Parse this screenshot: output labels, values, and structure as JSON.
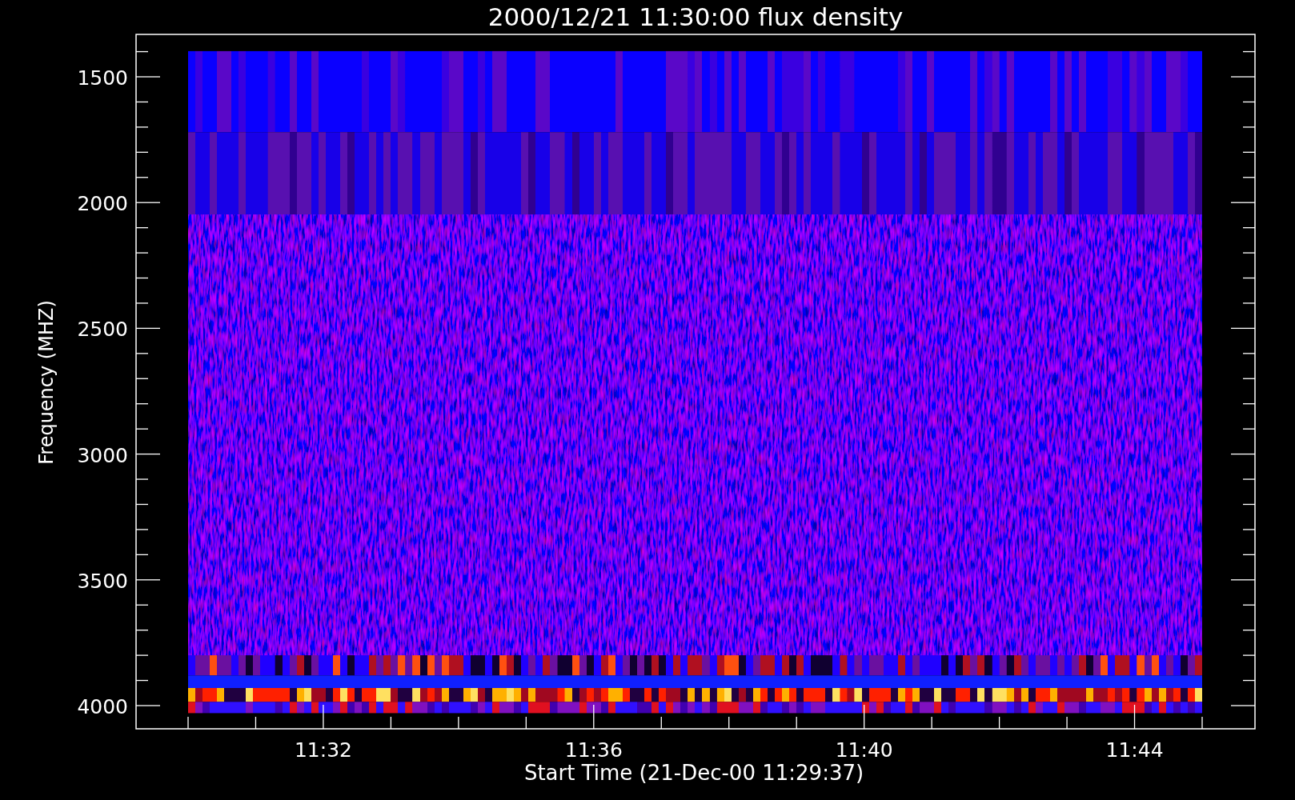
{
  "title": "2000/12/21 11:30:00 flux density",
  "y_axis": {
    "label": "Frequency (MHZ)",
    "ticks": [
      "1500",
      "2000",
      "2500",
      "3000",
      "3500",
      "4000"
    ]
  },
  "x_axis": {
    "label": "Start Time (21-Dec-00 11:29:37)",
    "ticks": [
      "11:32",
      "11:36",
      "11:40",
      "11:44"
    ]
  }
}
